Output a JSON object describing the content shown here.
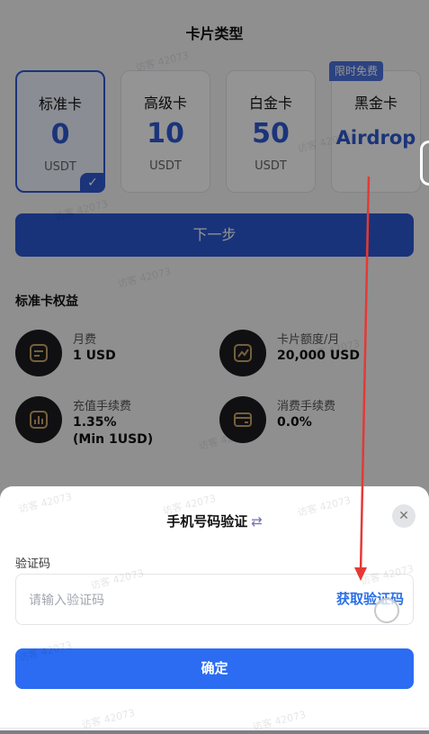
{
  "header": {
    "title": "卡片类型"
  },
  "cards": [
    {
      "name": "标准卡",
      "value": "0",
      "unit": "USDT"
    },
    {
      "name": "高级卡",
      "value": "10",
      "unit": "USDT"
    },
    {
      "name": "白金卡",
      "value": "50",
      "unit": "USDT"
    },
    {
      "name": "黑金卡",
      "value": "Airdrop",
      "badge": "限时免费"
    }
  ],
  "next_button": "下一步",
  "benefits": {
    "title": "标准卡权益",
    "items": [
      {
        "label": "月费",
        "value": "1 USD",
        "icon": "card-document-icon"
      },
      {
        "label": "卡片额度/月",
        "value": "20,000 USD",
        "icon": "trend-chart-icon"
      },
      {
        "label": "充值手续费",
        "value": "1.35%",
        "value2": "(Min 1USD)",
        "icon": "bar-chart-icon"
      },
      {
        "label": "消费手续费",
        "value": "0.0%",
        "icon": "wallet-icon"
      }
    ]
  },
  "sheet": {
    "title": "手机号码验证",
    "swap_glyph": "⇄",
    "code_label": "验证码",
    "code_placeholder": "请输入验证码",
    "get_code": "获取验证码",
    "confirm": "确定"
  },
  "watermark": "访客 42073",
  "colors": {
    "accent": "#2b59d2",
    "annotation": "#e53935",
    "confirm": "#2b6cf2"
  }
}
